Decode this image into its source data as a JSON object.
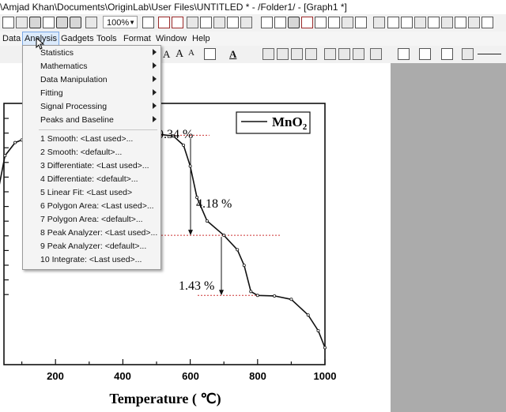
{
  "window": {
    "title": "\\Amjad Khan\\Documents\\OriginLab\\User Files\\UNTITLED * - /Folder1/ - [Graph1 *]"
  },
  "toolbar": {
    "zoom_value": "100%"
  },
  "menubar": {
    "items": [
      {
        "label": "Data"
      },
      {
        "label": "Analysis"
      },
      {
        "label": "Gadgets"
      },
      {
        "label": "Tools"
      },
      {
        "label": "Format"
      },
      {
        "label": "Window"
      },
      {
        "label": "Help"
      }
    ],
    "active": "Analysis"
  },
  "analysis_menu": {
    "submenus": [
      {
        "label": "Statistics"
      },
      {
        "label": "Mathematics"
      },
      {
        "label": "Data Manipulation"
      },
      {
        "label": "Fitting"
      },
      {
        "label": "Signal Processing"
      },
      {
        "label": "Peaks and Baseline"
      }
    ],
    "recent": [
      {
        "label": "1 Smooth: <Last used>..."
      },
      {
        "label": "2 Smooth: <default>..."
      },
      {
        "label": "3 Differentiate: <Last used>..."
      },
      {
        "label": "4 Differentiate: <default>..."
      },
      {
        "label": "5 Linear Fit: <Last used>"
      },
      {
        "label": "6 Polygon Area: <Last used>..."
      },
      {
        "label": "7 Polygon Area: <default>..."
      },
      {
        "label": "8 Peak Analyzer: <Last used>..."
      },
      {
        "label": "9 Peak Analyzer: <default>..."
      },
      {
        "label": "10 Integrate: <Last used>..."
      }
    ]
  },
  "format_toolbar": {
    "font_a": "A",
    "font_a_large": "A",
    "font_a_small": "A"
  },
  "graph": {
    "legend": {
      "label": "MnO",
      "subscript": "2"
    },
    "annotations": [
      {
        "text": "0.34 %"
      },
      {
        "text": "4.18 %"
      },
      {
        "text": "1.43 %"
      }
    ],
    "x_ticks": [
      "200",
      "400",
      "600",
      "800",
      "1000"
    ],
    "xlabel": "Temperature ( ℃)"
  },
  "chart_data": {
    "type": "line",
    "title": "",
    "xlabel": "Temperature ( ℃)",
    "ylabel": "",
    "xlim": [
      0,
      1000
    ],
    "x_ticks": [
      200,
      400,
      600,
      800,
      1000
    ],
    "series": [
      {
        "name": "MnO2",
        "x": [
          0,
          20,
          50,
          80,
          100,
          150,
          200,
          300,
          400,
          450,
          500,
          550,
          580,
          600,
          620,
          650,
          700,
          740,
          760,
          780,
          800,
          850,
          900,
          950,
          980,
          1000
        ],
        "y": [
          12,
          60,
          80,
          85,
          86,
          87,
          87.5,
          88,
          88.3,
          88.4,
          88.3,
          87.5,
          84,
          76,
          64,
          55,
          49.5,
          44,
          38,
          28,
          26.5,
          26.3,
          25,
          19,
          13,
          6.5
        ]
      }
    ],
    "ylim": [
      0,
      100
    ],
    "colors": {
      "line": "#111111",
      "guide": "#cc3333"
    }
  }
}
